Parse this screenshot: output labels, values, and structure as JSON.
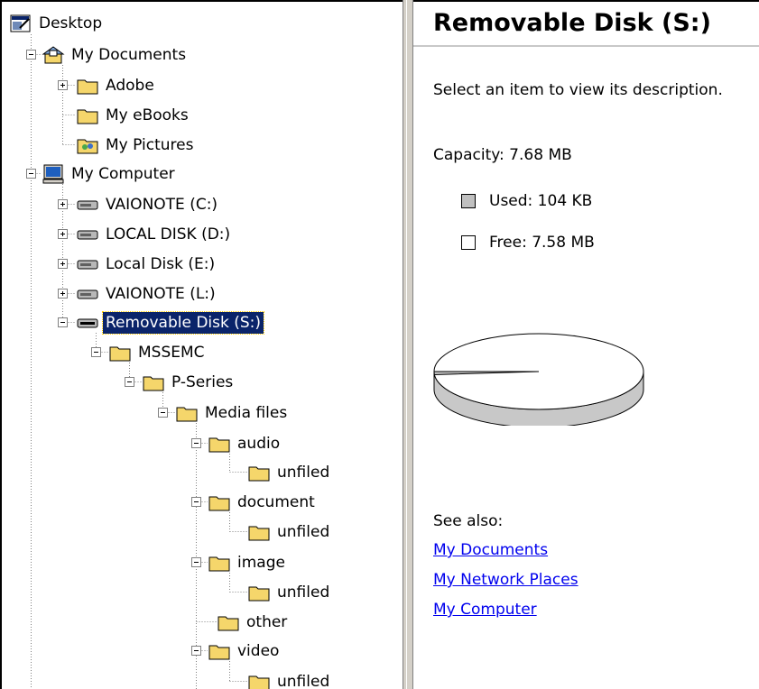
{
  "tree": {
    "items": [
      {
        "label": "Desktop",
        "icon": "desktop-icon"
      },
      {
        "label": "My Documents",
        "icon": "my-documents-icon"
      },
      {
        "label": "Adobe",
        "icon": "folder-icon"
      },
      {
        "label": "My eBooks",
        "icon": "folder-icon"
      },
      {
        "label": "My Pictures",
        "icon": "pictures-folder-icon"
      },
      {
        "label": "My Computer",
        "icon": "my-computer-icon"
      },
      {
        "label": "VAIONOTE (C:)",
        "icon": "drive-icon"
      },
      {
        "label": "LOCAL DISK (D:)",
        "icon": "drive-icon"
      },
      {
        "label": "Local Disk (E:)",
        "icon": "drive-icon"
      },
      {
        "label": "VAIONOTE (L:)",
        "icon": "drive-icon"
      },
      {
        "label": "Removable Disk (S:)",
        "icon": "removable-disk-icon",
        "selected": true
      },
      {
        "label": "MSSEMC",
        "icon": "folder-icon"
      },
      {
        "label": "P-Series",
        "icon": "folder-icon"
      },
      {
        "label": "Media files",
        "icon": "folder-icon"
      },
      {
        "label": "audio",
        "icon": "folder-icon"
      },
      {
        "label": "unfiled",
        "icon": "folder-icon"
      },
      {
        "label": "document",
        "icon": "folder-icon"
      },
      {
        "label": "unfiled",
        "icon": "folder-icon"
      },
      {
        "label": "image",
        "icon": "folder-icon"
      },
      {
        "label": "unfiled",
        "icon": "folder-icon"
      },
      {
        "label": "other",
        "icon": "folder-icon"
      },
      {
        "label": "video",
        "icon": "folder-icon"
      },
      {
        "label": "unfiled",
        "icon": "folder-icon"
      }
    ]
  },
  "detail": {
    "title": "Removable Disk (S:)",
    "description": "Select an item to view its description.",
    "capacity": "Capacity: 7.68 MB",
    "used": "Used: 104 KB",
    "free": "Free: 7.58 MB",
    "used_fraction": 0.0132,
    "see_also_label": "See also:",
    "links": [
      "My Documents",
      "My Network Places",
      "My Computer"
    ]
  },
  "colors": {
    "selection": "#0a246a",
    "link": "#0000ee",
    "used_swatch": "#c0c0c0",
    "free_swatch": "#ffffff",
    "folder": "#f5d66b",
    "splitter": "#d4d0c8"
  }
}
